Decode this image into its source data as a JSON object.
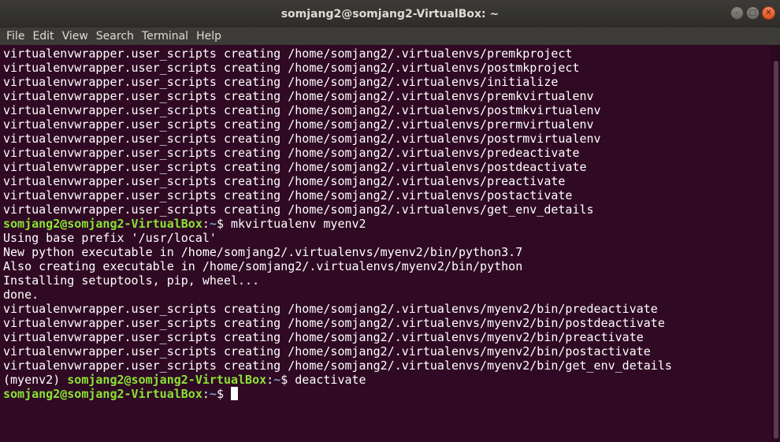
{
  "window": {
    "title": "somjang2@somjang2-VirtualBox: ~",
    "buttons": {
      "minimize": "–",
      "maximize": "□",
      "close": "✕"
    }
  },
  "menu": [
    "File",
    "Edit",
    "View",
    "Search",
    "Terminal",
    "Help"
  ],
  "terminal": {
    "output_top": [
      "virtualenvwrapper.user_scripts creating /home/somjang2/.virtualenvs/premkproject",
      "virtualenvwrapper.user_scripts creating /home/somjang2/.virtualenvs/postmkproject",
      "virtualenvwrapper.user_scripts creating /home/somjang2/.virtualenvs/initialize",
      "virtualenvwrapper.user_scripts creating /home/somjang2/.virtualenvs/premkvirtualenv",
      "virtualenvwrapper.user_scripts creating /home/somjang2/.virtualenvs/postmkvirtualenv",
      "virtualenvwrapper.user_scripts creating /home/somjang2/.virtualenvs/prermvirtualenv",
      "virtualenvwrapper.user_scripts creating /home/somjang2/.virtualenvs/postrmvirtualenv",
      "virtualenvwrapper.user_scripts creating /home/somjang2/.virtualenvs/predeactivate",
      "virtualenvwrapper.user_scripts creating /home/somjang2/.virtualenvs/postdeactivate",
      "virtualenvwrapper.user_scripts creating /home/somjang2/.virtualenvs/preactivate",
      "virtualenvwrapper.user_scripts creating /home/somjang2/.virtualenvs/postactivate",
      "virtualenvwrapper.user_scripts creating /home/somjang2/.virtualenvs/get_env_details"
    ],
    "prompt1": {
      "user": "somjang2@somjang2-VirtualBox",
      "path": "~",
      "symbol": "$",
      "command": " mkvirtualenv myenv2"
    },
    "output_mid": [
      "Using base prefix '/usr/local'",
      "New python executable in /home/somjang2/.virtualenvs/myenv2/bin/python3.7",
      "Also creating executable in /home/somjang2/.virtualenvs/myenv2/bin/python",
      "Installing setuptools, pip, wheel...",
      "done.",
      "virtualenvwrapper.user_scripts creating /home/somjang2/.virtualenvs/myenv2/bin/predeactivate",
      "virtualenvwrapper.user_scripts creating /home/somjang2/.virtualenvs/myenv2/bin/postdeactivate",
      "virtualenvwrapper.user_scripts creating /home/somjang2/.virtualenvs/myenv2/bin/preactivate",
      "virtualenvwrapper.user_scripts creating /home/somjang2/.virtualenvs/myenv2/bin/postactivate",
      "virtualenvwrapper.user_scripts creating /home/somjang2/.virtualenvs/myenv2/bin/get_env_details"
    ],
    "prompt2": {
      "venv": "(myenv2) ",
      "user": "somjang2@somjang2-VirtualBox",
      "path": "~",
      "symbol": "$",
      "command": " deactivate"
    },
    "prompt3": {
      "user": "somjang2@somjang2-VirtualBox",
      "path": "~",
      "symbol": "$",
      "command": " "
    }
  },
  "colors": {
    "background": "#300a24",
    "prompt_user": "#8ae234",
    "prompt_path": "#729fcf",
    "text": "#ffffff"
  }
}
